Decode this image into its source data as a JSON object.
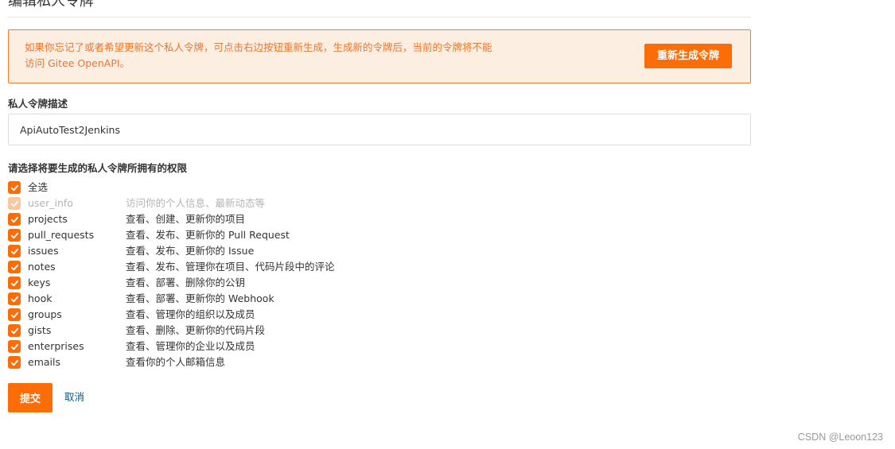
{
  "page": {
    "title": "编辑私人令牌"
  },
  "notice": {
    "text": "如果你忘记了或者希望更新这个私人令牌，可点击右边按钮重新生成，生成新的令牌后，当前的令牌将不能\n访问 Gitee OpenAPI。",
    "regenerate_label": "重新生成令牌"
  },
  "description": {
    "label": "私人令牌描述",
    "value": "ApiAutoTest2Jenkins"
  },
  "permissions": {
    "label": "请选择将要生成的私人令牌所拥有的权限",
    "select_all_label": "全选",
    "items": [
      {
        "name": "user_info",
        "desc": "访问你的个人信息、最新动态等",
        "checked": true,
        "disabled": true
      },
      {
        "name": "projects",
        "desc": "查看、创建、更新你的项目",
        "checked": true,
        "disabled": false
      },
      {
        "name": "pull_requests",
        "desc": "查看、发布、更新你的 Pull Request",
        "checked": true,
        "disabled": false
      },
      {
        "name": "issues",
        "desc": "查看、发布、更新你的 Issue",
        "checked": true,
        "disabled": false
      },
      {
        "name": "notes",
        "desc": "查看、发布、管理你在项目、代码片段中的评论",
        "checked": true,
        "disabled": false
      },
      {
        "name": "keys",
        "desc": "查看、部署、删除你的公钥",
        "checked": true,
        "disabled": false
      },
      {
        "name": "hook",
        "desc": "查看、部署、更新你的 Webhook",
        "checked": true,
        "disabled": false
      },
      {
        "name": "groups",
        "desc": "查看、管理你的组织以及成员",
        "checked": true,
        "disabled": false
      },
      {
        "name": "gists",
        "desc": "查看、删除、更新你的代码片段",
        "checked": true,
        "disabled": false
      },
      {
        "name": "enterprises",
        "desc": "查看、管理你的企业以及成员",
        "checked": true,
        "disabled": false
      },
      {
        "name": "emails",
        "desc": "查看你的个人邮箱信息",
        "checked": true,
        "disabled": false
      }
    ]
  },
  "actions": {
    "submit_label": "提交",
    "cancel_label": "取消"
  },
  "watermark": "CSDN @Leoon123",
  "colors": {
    "accent": "#fc6d08",
    "notice_bg": "#fdeee2",
    "notice_text": "#f0742a",
    "link": "#005980"
  },
  "icons": {
    "checkbox": "check-icon"
  }
}
